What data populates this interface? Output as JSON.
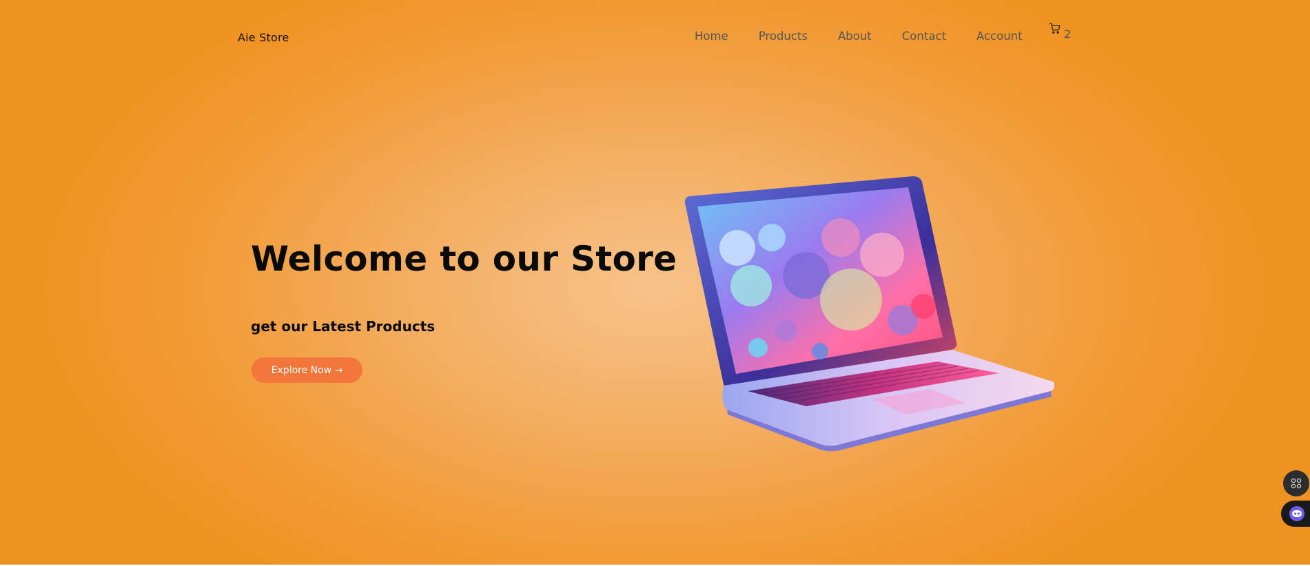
{
  "header": {
    "brand": "Aie Store",
    "nav": [
      "Home",
      "Products",
      "About",
      "Contact",
      "Account"
    ],
    "cart_count": "2",
    "cart_icon": "cart-icon"
  },
  "hero": {
    "title": "Welcome to our Store",
    "subtitle": "get our Latest Products",
    "cta_label": "Explore Now →",
    "image": "laptop-illustration"
  },
  "widgets": {
    "grid_icon": "grid-icon",
    "bot_icon": "chatbot-icon"
  },
  "colors": {
    "background": "#f29d3c",
    "accent": "#f3763a",
    "text": "#0a0a0a"
  }
}
